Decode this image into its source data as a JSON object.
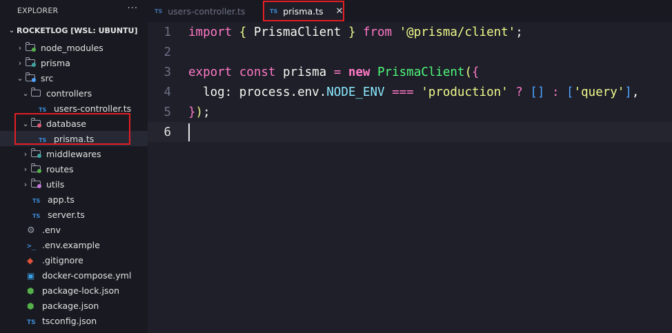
{
  "explorer": {
    "title": "EXPLORER",
    "more": "···",
    "root": "ROCKETLOG [WSL: UBUNTU]",
    "items": [
      {
        "label": "node_modules"
      },
      {
        "label": "prisma"
      },
      {
        "label": "src"
      },
      {
        "label": "controllers"
      },
      {
        "label": "users-controller.ts"
      },
      {
        "label": "database"
      },
      {
        "label": "prisma.ts"
      },
      {
        "label": "middlewares"
      },
      {
        "label": "routes"
      },
      {
        "label": "utils"
      },
      {
        "label": "app.ts"
      },
      {
        "label": "server.ts"
      },
      {
        "label": ".env"
      },
      {
        "label": ".env.example"
      },
      {
        "label": ".gitignore"
      },
      {
        "label": "docker-compose.yml"
      },
      {
        "label": "package-lock.json"
      },
      {
        "label": "package.json"
      },
      {
        "label": "tsconfig.json"
      }
    ]
  },
  "tabs": [
    {
      "label": "users-controller.ts",
      "badge": "TS"
    },
    {
      "label": "prisma.ts",
      "badge": "TS",
      "close": "✕"
    }
  ],
  "editor": {
    "line_numbers": [
      "1",
      "2",
      "3",
      "4",
      "5",
      "6"
    ],
    "tokens": {
      "import": "import",
      "brace_open": "{",
      "prisma_client": "PrismaClient",
      "brace_close": "}",
      "from": "from",
      "module": "'@prisma/client'",
      "semi": ";",
      "export": "export",
      "const": "const",
      "prisma": "prisma",
      "eq": "=",
      "new": "new",
      "ctor": "PrismaClient",
      "paren_open": "(",
      "obj_open": "{",
      "log": "log",
      "colon": ":",
      "process": "process",
      "dot": ".",
      "env": "env",
      "node_env": "NODE_ENV",
      "strict_eq": "===",
      "production": "'production'",
      "q": "?",
      "empty_arr": "[]",
      "c2": ":",
      "arr_open": "[",
      "query": "'query'",
      "arr_close": "]",
      "comma": ",",
      "close_obj": "}",
      "close_paren": ")",
      "close_semi": ";"
    }
  },
  "colors": {
    "highlight": "#e51e25",
    "keyword": "#ff79c6",
    "string": "#f1fa8c",
    "class": "#50fa7b",
    "property": "#8be9fd"
  }
}
